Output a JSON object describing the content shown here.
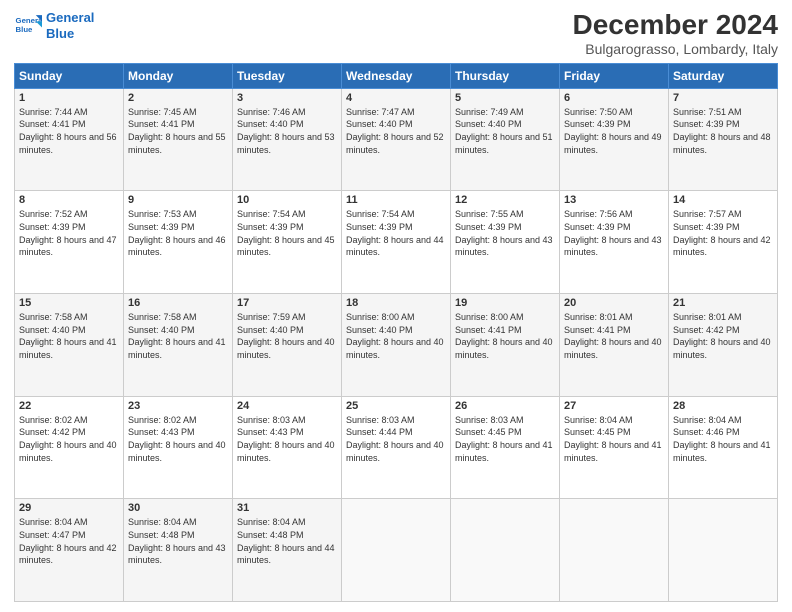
{
  "logo": {
    "line1": "General",
    "line2": "Blue"
  },
  "title": "December 2024",
  "subtitle": "Bulgarograsso, Lombardy, Italy",
  "weekdays": [
    "Sunday",
    "Monday",
    "Tuesday",
    "Wednesday",
    "Thursday",
    "Friday",
    "Saturday"
  ],
  "weeks": [
    [
      {
        "day": "1",
        "sunrise": "7:44 AM",
        "sunset": "4:41 PM",
        "daylight": "8 hours and 56 minutes."
      },
      {
        "day": "2",
        "sunrise": "7:45 AM",
        "sunset": "4:41 PM",
        "daylight": "8 hours and 55 minutes."
      },
      {
        "day": "3",
        "sunrise": "7:46 AM",
        "sunset": "4:40 PM",
        "daylight": "8 hours and 53 minutes."
      },
      {
        "day": "4",
        "sunrise": "7:47 AM",
        "sunset": "4:40 PM",
        "daylight": "8 hours and 52 minutes."
      },
      {
        "day": "5",
        "sunrise": "7:49 AM",
        "sunset": "4:40 PM",
        "daylight": "8 hours and 51 minutes."
      },
      {
        "day": "6",
        "sunrise": "7:50 AM",
        "sunset": "4:39 PM",
        "daylight": "8 hours and 49 minutes."
      },
      {
        "day": "7",
        "sunrise": "7:51 AM",
        "sunset": "4:39 PM",
        "daylight": "8 hours and 48 minutes."
      }
    ],
    [
      {
        "day": "8",
        "sunrise": "7:52 AM",
        "sunset": "4:39 PM",
        "daylight": "8 hours and 47 minutes."
      },
      {
        "day": "9",
        "sunrise": "7:53 AM",
        "sunset": "4:39 PM",
        "daylight": "8 hours and 46 minutes."
      },
      {
        "day": "10",
        "sunrise": "7:54 AM",
        "sunset": "4:39 PM",
        "daylight": "8 hours and 45 minutes."
      },
      {
        "day": "11",
        "sunrise": "7:54 AM",
        "sunset": "4:39 PM",
        "daylight": "8 hours and 44 minutes."
      },
      {
        "day": "12",
        "sunrise": "7:55 AM",
        "sunset": "4:39 PM",
        "daylight": "8 hours and 43 minutes."
      },
      {
        "day": "13",
        "sunrise": "7:56 AM",
        "sunset": "4:39 PM",
        "daylight": "8 hours and 43 minutes."
      },
      {
        "day": "14",
        "sunrise": "7:57 AM",
        "sunset": "4:39 PM",
        "daylight": "8 hours and 42 minutes."
      }
    ],
    [
      {
        "day": "15",
        "sunrise": "7:58 AM",
        "sunset": "4:40 PM",
        "daylight": "8 hours and 41 minutes."
      },
      {
        "day": "16",
        "sunrise": "7:58 AM",
        "sunset": "4:40 PM",
        "daylight": "8 hours and 41 minutes."
      },
      {
        "day": "17",
        "sunrise": "7:59 AM",
        "sunset": "4:40 PM",
        "daylight": "8 hours and 40 minutes."
      },
      {
        "day": "18",
        "sunrise": "8:00 AM",
        "sunset": "4:40 PM",
        "daylight": "8 hours and 40 minutes."
      },
      {
        "day": "19",
        "sunrise": "8:00 AM",
        "sunset": "4:41 PM",
        "daylight": "8 hours and 40 minutes."
      },
      {
        "day": "20",
        "sunrise": "8:01 AM",
        "sunset": "4:41 PM",
        "daylight": "8 hours and 40 minutes."
      },
      {
        "day": "21",
        "sunrise": "8:01 AM",
        "sunset": "4:42 PM",
        "daylight": "8 hours and 40 minutes."
      }
    ],
    [
      {
        "day": "22",
        "sunrise": "8:02 AM",
        "sunset": "4:42 PM",
        "daylight": "8 hours and 40 minutes."
      },
      {
        "day": "23",
        "sunrise": "8:02 AM",
        "sunset": "4:43 PM",
        "daylight": "8 hours and 40 minutes."
      },
      {
        "day": "24",
        "sunrise": "8:03 AM",
        "sunset": "4:43 PM",
        "daylight": "8 hours and 40 minutes."
      },
      {
        "day": "25",
        "sunrise": "8:03 AM",
        "sunset": "4:44 PM",
        "daylight": "8 hours and 40 minutes."
      },
      {
        "day": "26",
        "sunrise": "8:03 AM",
        "sunset": "4:45 PM",
        "daylight": "8 hours and 41 minutes."
      },
      {
        "day": "27",
        "sunrise": "8:04 AM",
        "sunset": "4:45 PM",
        "daylight": "8 hours and 41 minutes."
      },
      {
        "day": "28",
        "sunrise": "8:04 AM",
        "sunset": "4:46 PM",
        "daylight": "8 hours and 41 minutes."
      }
    ],
    [
      {
        "day": "29",
        "sunrise": "8:04 AM",
        "sunset": "4:47 PM",
        "daylight": "8 hours and 42 minutes."
      },
      {
        "day": "30",
        "sunrise": "8:04 AM",
        "sunset": "4:48 PM",
        "daylight": "8 hours and 43 minutes."
      },
      {
        "day": "31",
        "sunrise": "8:04 AM",
        "sunset": "4:48 PM",
        "daylight": "8 hours and 44 minutes."
      },
      null,
      null,
      null,
      null
    ]
  ],
  "labels": {
    "sunrise": "Sunrise:",
    "sunset": "Sunset:",
    "daylight": "Daylight:"
  }
}
